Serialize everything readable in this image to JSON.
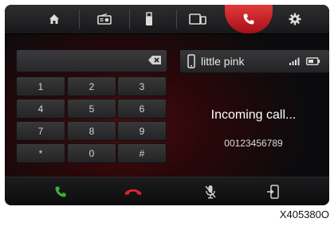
{
  "tabs": [
    {
      "id": "home",
      "icon": "home-icon"
    },
    {
      "id": "radio",
      "icon": "radio-icon"
    },
    {
      "id": "usb",
      "icon": "usb-icon"
    },
    {
      "id": "media",
      "icon": "media-icon"
    },
    {
      "id": "phone",
      "icon": "phone-icon",
      "active": true
    },
    {
      "id": "settings",
      "icon": "gear-icon"
    }
  ],
  "dialer": {
    "input_value": "",
    "keys": [
      "1",
      "2",
      "3",
      "4",
      "5",
      "6",
      "7",
      "8",
      "9",
      "*",
      "0",
      "#"
    ]
  },
  "device": {
    "name": "little pink",
    "icons": [
      "smartphone-icon",
      "signal-icon",
      "battery-icon"
    ]
  },
  "call": {
    "status": "Incoming call...",
    "number": "00123456789"
  },
  "actions": [
    "accept-call-icon",
    "reject-call-icon",
    "mute-microphone-icon",
    "transfer-to-phone-icon"
  ],
  "colors": {
    "accent": "#d8222a",
    "accept": "#3fae3a",
    "reject": "#e0262d"
  },
  "figure_id": "X405380O"
}
